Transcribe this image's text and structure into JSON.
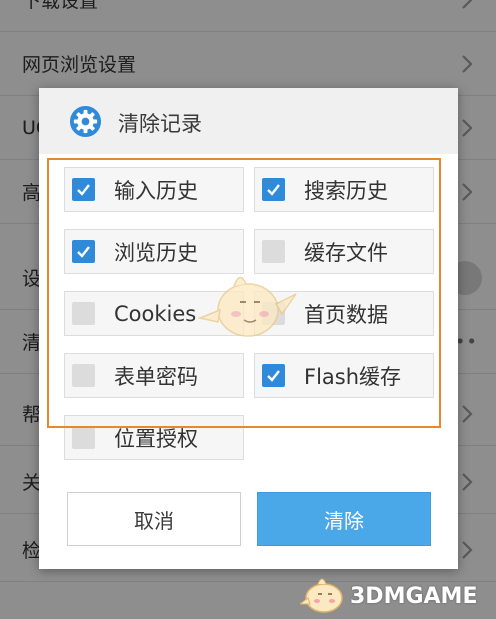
{
  "background_list": {
    "items": [
      {
        "label": "下载设置"
      },
      {
        "label": "网页浏览设置"
      },
      {
        "label": "UC"
      },
      {
        "label": "高"
      },
      {
        "label": "设"
      },
      {
        "label": "清"
      },
      {
        "label": "帮"
      },
      {
        "label": "关"
      },
      {
        "label": "检"
      }
    ]
  },
  "dialog": {
    "title": "清除记录",
    "options": [
      {
        "label": "输入历史",
        "checked": true
      },
      {
        "label": "搜索历史",
        "checked": true
      },
      {
        "label": "浏览历史",
        "checked": true
      },
      {
        "label": "缓存文件",
        "checked": false
      },
      {
        "label": "Cookies",
        "checked": false
      },
      {
        "label": "首页数据",
        "checked": false
      },
      {
        "label": "表单密码",
        "checked": false
      },
      {
        "label": "Flash缓存",
        "checked": true
      },
      {
        "label": "位置授权",
        "checked": false
      }
    ],
    "cancel_label": "取消",
    "confirm_label": "清除"
  },
  "watermark": {
    "text": "3DMGAME"
  },
  "colors": {
    "accent": "#4aa8e8",
    "checkbox_checked": "#2f8bd9",
    "highlight_box": "#e48a2e"
  }
}
